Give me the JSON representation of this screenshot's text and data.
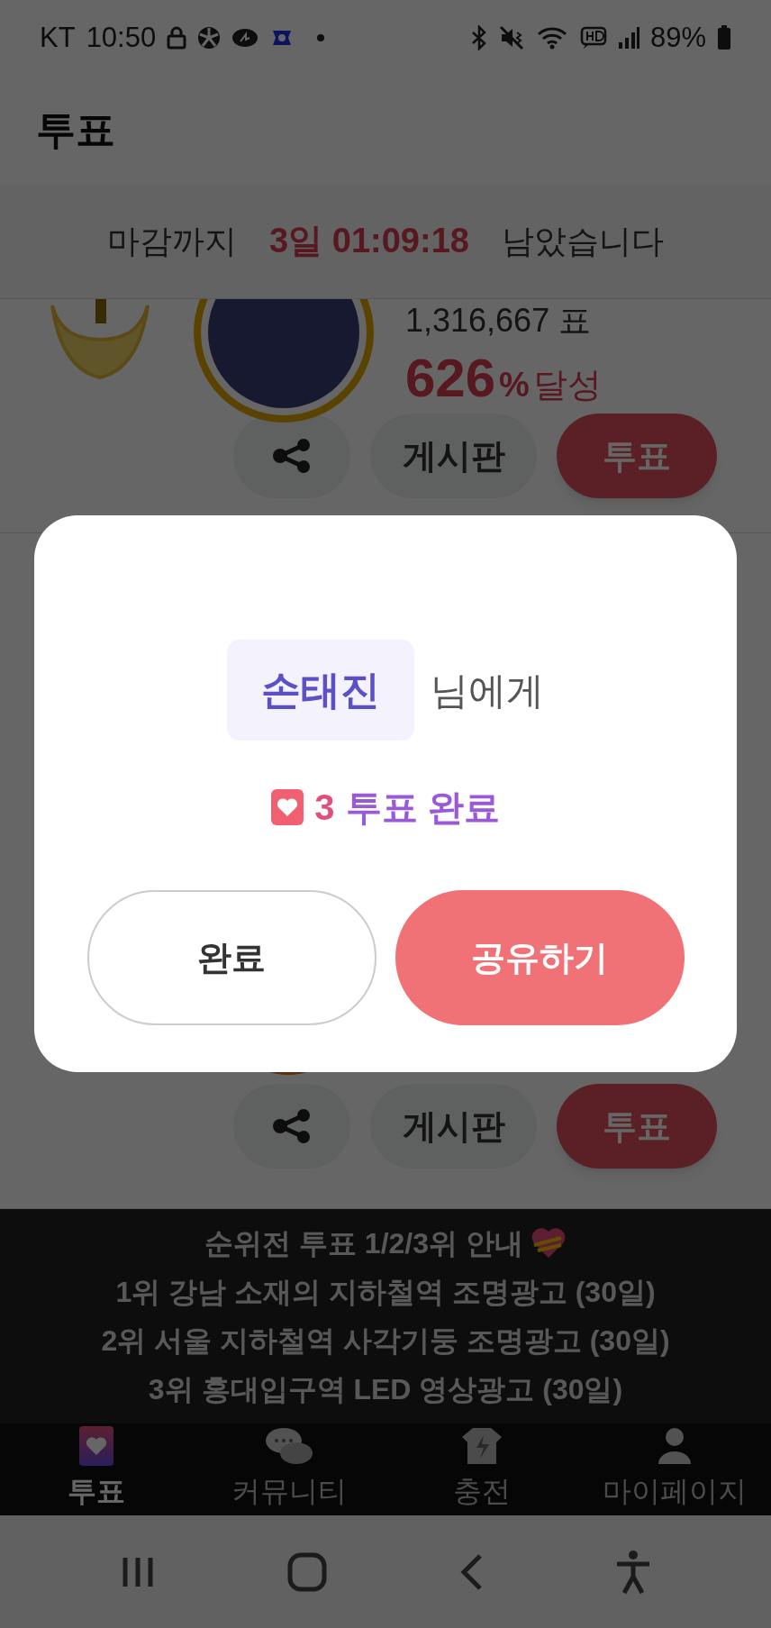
{
  "status_bar": {
    "carrier": "KT",
    "time": "10:50",
    "battery": "89%"
  },
  "header": {
    "title": "투표"
  },
  "countdown": {
    "prefix": "마감까지",
    "remaining": "3일 01:09:18",
    "suffix": "남았습니다"
  },
  "cards": [
    {
      "votes": "1,316,667 표",
      "percent": "626",
      "percent_unit": "%",
      "achieved": "달성",
      "board": "게시판",
      "vote": "투표"
    },
    {
      "board": "게시판",
      "vote": "투표"
    }
  ],
  "banner": {
    "lines": [
      "순위전 투표 1/2/3위 안내",
      "1위 강남 소재의 지하철역 조명광고 (30일)",
      "2위 서울 지하철역 사각기둥 조명광고 (30일)",
      "3위 홍대입구역 LED 영상광고 (30일)"
    ]
  },
  "nav": [
    {
      "label": "투표",
      "kind": "vote",
      "selected": true
    },
    {
      "label": "커뮤니티",
      "kind": "community",
      "selected": false
    },
    {
      "label": "충전",
      "kind": "charge",
      "selected": false
    },
    {
      "label": "마이페이지",
      "kind": "mypage",
      "selected": false
    }
  ],
  "dialog": {
    "name": "손태진",
    "name_suffix": "님에게",
    "count": "3",
    "result": "투표 완료",
    "buttons": [
      {
        "label": "완료",
        "kind": "outline"
      },
      {
        "label": "공유하기",
        "kind": "primary"
      }
    ]
  }
}
